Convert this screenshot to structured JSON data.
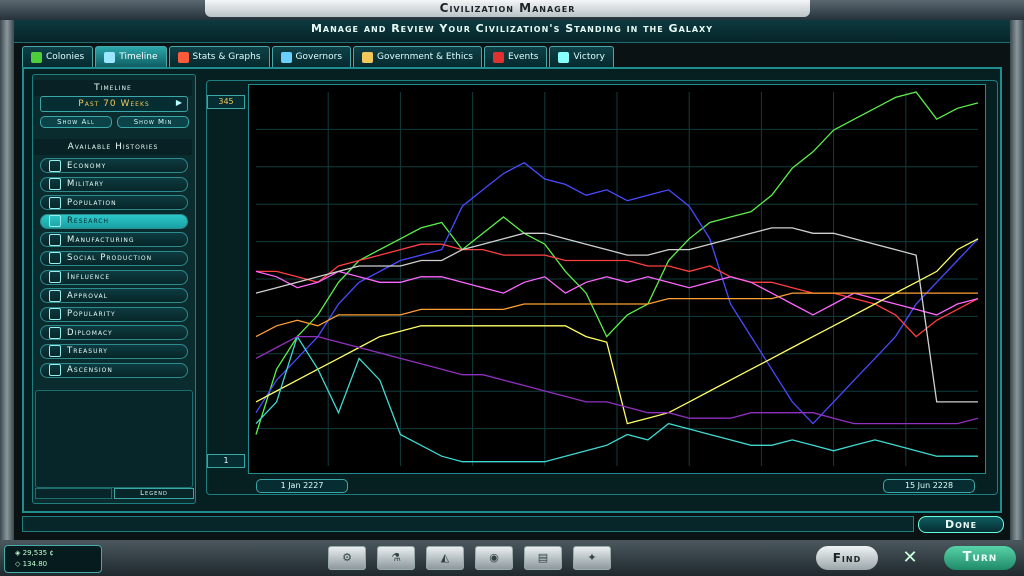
{
  "window": {
    "title": "Civilization Manager",
    "subtitle": "Manage and Review Your Civilization's Standing in the Galaxy"
  },
  "tabs": [
    {
      "label": "Colonies",
      "icon": "leaf-icon",
      "color": "#4ccf3a"
    },
    {
      "label": "Timeline",
      "icon": "timeline-icon",
      "color": "#9be7ff",
      "active": true
    },
    {
      "label": "Stats & Graphs",
      "icon": "bar-graph-icon",
      "color": "#ff5a3a"
    },
    {
      "label": "Governors",
      "icon": "governor-icon",
      "color": "#6ad0ff"
    },
    {
      "label": "Government & Ethics",
      "icon": "scales-icon",
      "color": "#f3c85a"
    },
    {
      "label": "Events",
      "icon": "alert-icon",
      "color": "#e03030"
    },
    {
      "label": "Victory",
      "icon": "flag-icon",
      "color": "#8ff"
    }
  ],
  "timeline": {
    "header": "Timeline",
    "period": "Past 70 Weeks",
    "show_all": "Show All",
    "show_min": "Show Min"
  },
  "histories": {
    "header": "Available Histories",
    "items": [
      {
        "label": "Economy",
        "icon": "economy-icon"
      },
      {
        "label": "Military",
        "icon": "sword-icon"
      },
      {
        "label": "Population",
        "icon": "population-icon"
      },
      {
        "label": "Research",
        "icon": "research-icon",
        "active": true
      },
      {
        "label": "Manufacturing",
        "icon": "gear-icon"
      },
      {
        "label": "Social Production",
        "icon": "social-icon"
      },
      {
        "label": "Influence",
        "icon": "influence-icon"
      },
      {
        "label": "Approval",
        "icon": "smile-icon"
      },
      {
        "label": "Popularity",
        "icon": "popularity-icon"
      },
      {
        "label": "Diplomacy",
        "icon": "diplomacy-icon"
      },
      {
        "label": "Treasury",
        "icon": "treasury-icon"
      },
      {
        "label": "Ascension",
        "icon": "ascension-icon"
      }
    ],
    "legend_label": "Legend"
  },
  "graph": {
    "y_max_label": "345",
    "y_min_label": "1",
    "x_start_label": "1 Jan 2227",
    "x_end_label": "15 Jun 2228"
  },
  "chart_data": {
    "type": "line",
    "ylim": [
      1,
      345
    ],
    "series": [
      {
        "color": "#5cf04a",
        "values": [
          30,
          90,
          120,
          140,
          170,
          190,
          200,
          210,
          220,
          225,
          200,
          215,
          230,
          215,
          205,
          180,
          160,
          120,
          140,
          150,
          190,
          210,
          225,
          230,
          235,
          250,
          275,
          290,
          310,
          320,
          330,
          340,
          345,
          320,
          330,
          335
        ]
      },
      {
        "color": "#4a4aff",
        "values": [
          50,
          80,
          100,
          120,
          150,
          170,
          180,
          190,
          195,
          200,
          240,
          255,
          270,
          280,
          265,
          260,
          250,
          255,
          245,
          250,
          255,
          240,
          210,
          150,
          120,
          90,
          60,
          40,
          60,
          80,
          100,
          120,
          150,
          170,
          190,
          210
        ]
      },
      {
        "color": "#ff4040",
        "values": [
          180,
          180,
          175,
          170,
          185,
          190,
          195,
          200,
          205,
          205,
          200,
          200,
          195,
          195,
          195,
          190,
          190,
          190,
          190,
          185,
          185,
          180,
          185,
          175,
          170,
          170,
          165,
          160,
          160,
          155,
          150,
          140,
          120,
          135,
          145,
          155
        ]
      },
      {
        "color": "#ff66ff",
        "values": [
          180,
          175,
          165,
          170,
          180,
          175,
          170,
          170,
          175,
          175,
          170,
          165,
          160,
          170,
          175,
          160,
          170,
          175,
          170,
          175,
          170,
          165,
          170,
          175,
          170,
          160,
          150,
          140,
          150,
          160,
          155,
          150,
          145,
          140,
          150,
          155
        ]
      },
      {
        "color": "#ffa030",
        "values": [
          120,
          130,
          135,
          130,
          140,
          140,
          140,
          140,
          145,
          145,
          145,
          145,
          145,
          150,
          150,
          150,
          150,
          150,
          150,
          150,
          155,
          155,
          155,
          155,
          155,
          155,
          160,
          160,
          160,
          160,
          160,
          160,
          160,
          160,
          160,
          160
        ]
      },
      {
        "color": "#ffff66",
        "values": [
          60,
          70,
          80,
          90,
          100,
          110,
          120,
          125,
          130,
          130,
          130,
          130,
          130,
          130,
          130,
          130,
          120,
          115,
          40,
          45,
          50,
          60,
          70,
          80,
          90,
          100,
          110,
          120,
          130,
          140,
          150,
          160,
          170,
          180,
          200,
          210
        ]
      },
      {
        "color": "#40d8d0",
        "values": [
          40,
          60,
          120,
          90,
          50,
          100,
          80,
          30,
          20,
          10,
          5,
          5,
          5,
          5,
          5,
          10,
          15,
          20,
          30,
          25,
          40,
          35,
          30,
          25,
          20,
          20,
          25,
          20,
          15,
          20,
          25,
          20,
          15,
          10,
          10,
          10
        ]
      },
      {
        "color": "#d0d0d0",
        "values": [
          160,
          165,
          170,
          175,
          180,
          185,
          185,
          185,
          190,
          190,
          200,
          205,
          210,
          215,
          215,
          210,
          205,
          200,
          195,
          195,
          200,
          200,
          205,
          210,
          215,
          220,
          220,
          215,
          215,
          210,
          205,
          200,
          195,
          60,
          60,
          60
        ]
      },
      {
        "color": "#9030c0",
        "values": [
          100,
          110,
          120,
          120,
          115,
          110,
          105,
          100,
          95,
          90,
          85,
          85,
          80,
          75,
          70,
          65,
          60,
          60,
          55,
          50,
          50,
          45,
          45,
          45,
          50,
          50,
          50,
          50,
          45,
          40,
          40,
          40,
          40,
          40,
          40,
          45
        ]
      }
    ]
  },
  "status": {
    "done": "Done",
    "credits": "29,535",
    "research": "134.80"
  },
  "bottombar": {
    "buttons": [
      {
        "icon": "colony-icon",
        "glyph": "⚙"
      },
      {
        "icon": "flask-icon",
        "glyph": "⚗"
      },
      {
        "icon": "planet-icon",
        "glyph": "◭"
      },
      {
        "icon": "starbase-icon",
        "glyph": "◉"
      },
      {
        "icon": "graph-icon",
        "glyph": "▤"
      },
      {
        "icon": "ship-icon",
        "glyph": "✦"
      }
    ],
    "find": "Find",
    "turn": "Turn"
  }
}
